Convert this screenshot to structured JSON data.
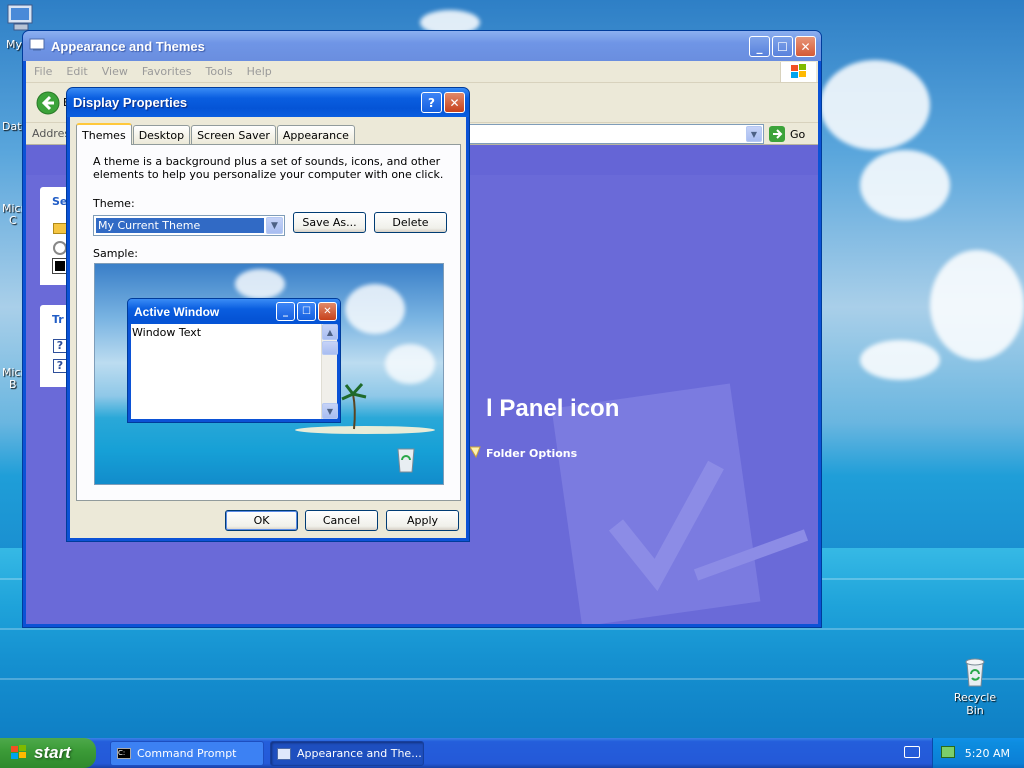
{
  "desktop": {
    "icons": [
      {
        "label": "My",
        "name": "my-computer-icon"
      },
      {
        "label": "Dat",
        "name": "data-icon"
      },
      {
        "label": "Micro\nC",
        "name": "microsoft-icon-1"
      },
      {
        "label": "Micro\nB",
        "name": "microsoft-icon-2"
      },
      {
        "label": "Recycle Bin",
        "name": "recycle-bin-icon"
      }
    ]
  },
  "control_panel": {
    "title": "Appearance and Themes",
    "menu": [
      "File",
      "Edit",
      "View",
      "Favorites",
      "Tools",
      "Help"
    ],
    "toolbar": {
      "back_label": "B"
    },
    "address": {
      "label": "Address",
      "go_label": "Go"
    },
    "side_labels": {
      "see_also": "Se",
      "troubleshooters": "Tr"
    },
    "heading": "l Panel icon",
    "folder_options": "Folder Options"
  },
  "dialog": {
    "title": "Display Properties",
    "tabs": [
      "Themes",
      "Desktop",
      "Screen Saver",
      "Appearance"
    ],
    "active_tab": "Themes",
    "description": "A theme is a background plus a set of sounds, icons, and other elements to help you personalize your computer with one click.",
    "theme_label": "Theme:",
    "theme_value": "My Current Theme",
    "save_as_label": "Save As...",
    "delete_label": "Delete",
    "sample_label": "Sample:",
    "sample_window": {
      "title": "Active Window",
      "text": "Window Text"
    },
    "ok_label": "OK",
    "cancel_label": "Cancel",
    "apply_label": "Apply"
  },
  "taskbar": {
    "start_label": "start",
    "tasks": [
      {
        "label": "Command Prompt"
      },
      {
        "label": "Appearance and The..."
      }
    ],
    "clock": "5:20 AM"
  }
}
